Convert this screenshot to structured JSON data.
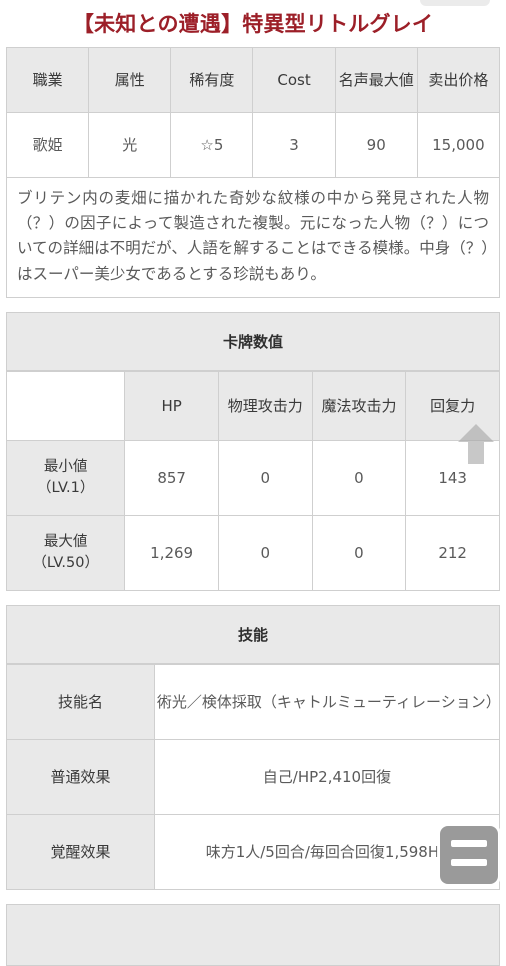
{
  "page": {
    "title": "【未知との遭遇】特異型リトルグレイ"
  },
  "profile_table": {
    "headers": [
      "職業",
      "属性",
      "稀有度",
      "Cost",
      "名声最大値",
      "卖出价格"
    ],
    "values": [
      "歌姫",
      "光",
      "☆5",
      "3",
      "90",
      "15,000"
    ]
  },
  "description": "ブリテン内の麦畑に描かれた奇妙な紋様の中から発見された人物（？）の因子によって製造された複製。元になった人物（？）についての詳細は不明だが、人語を解することはできる模様。中身（？）はスーパー美少女であるとする珍説もあり。",
  "stats_section": {
    "heading": "卡牌数值",
    "headers": [
      "",
      "HP",
      "物理攻击力",
      "魔法攻击力",
      "回复力"
    ],
    "rows": [
      {
        "label": "最小値\n（LV.1）",
        "label_line1": "最小値",
        "label_line2": "（LV.1）",
        "values": [
          "857",
          "0",
          "0",
          "143"
        ]
      },
      {
        "label": "最大値\n（LV.50）",
        "label_line1": "最大値",
        "label_line2": "（LV.50）",
        "values": [
          "1,269",
          "0",
          "0",
          "212"
        ]
      }
    ]
  },
  "skill_section": {
    "heading": "技能",
    "rows": [
      {
        "key": "技能名",
        "value": "術光／検体採取（キャトルミューティレーション）"
      },
      {
        "key": "普通效果",
        "value": "自己/HP2,410回復"
      },
      {
        "key": "覚醒效果",
        "value": "味方1人/5回合/毎回合回復1,598HP"
      }
    ]
  },
  "controls": {
    "scroll_top_icon": "arrow-up-icon",
    "menu_icon": "hamburger-menu-icon"
  },
  "colors": {
    "title": "#9c1f28",
    "header_bg": "#e9e9e9",
    "border": "#cfcfcf",
    "text": "#5a5a5a"
  }
}
